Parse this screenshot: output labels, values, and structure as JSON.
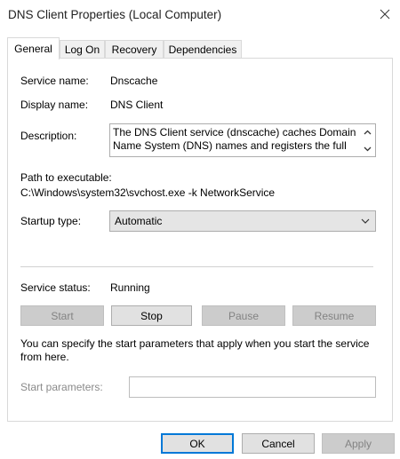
{
  "window": {
    "title": "DNS Client Properties (Local Computer)",
    "close_icon": "close-icon"
  },
  "tabs": [
    {
      "label": "General",
      "active": true
    },
    {
      "label": "Log On",
      "active": false
    },
    {
      "label": "Recovery",
      "active": false
    },
    {
      "label": "Dependencies",
      "active": false
    }
  ],
  "general": {
    "service_name_label": "Service name:",
    "service_name_value": "Dnscache",
    "display_name_label": "Display name:",
    "display_name_value": "DNS Client",
    "description_label": "Description:",
    "description_value": "The DNS Client service (dnscache) caches Domain Name System (DNS) names and registers the full",
    "path_label": "Path to executable:",
    "path_value": "C:\\Windows\\system32\\svchost.exe -k NetworkService",
    "startup_type_label": "Startup type:",
    "startup_type_value": "Automatic",
    "service_status_label": "Service status:",
    "service_status_value": "Running",
    "control_buttons": {
      "start": "Start",
      "stop": "Stop",
      "pause": "Pause",
      "resume": "Resume"
    },
    "start_params_text": "You can specify the start parameters that apply when you start the service from here.",
    "start_params_label": "Start parameters:",
    "start_params_value": ""
  },
  "footer": {
    "ok": "OK",
    "cancel": "Cancel",
    "apply": "Apply"
  },
  "colors": {
    "default_button_border": "#0078d7",
    "disabled_text": "#838383"
  }
}
